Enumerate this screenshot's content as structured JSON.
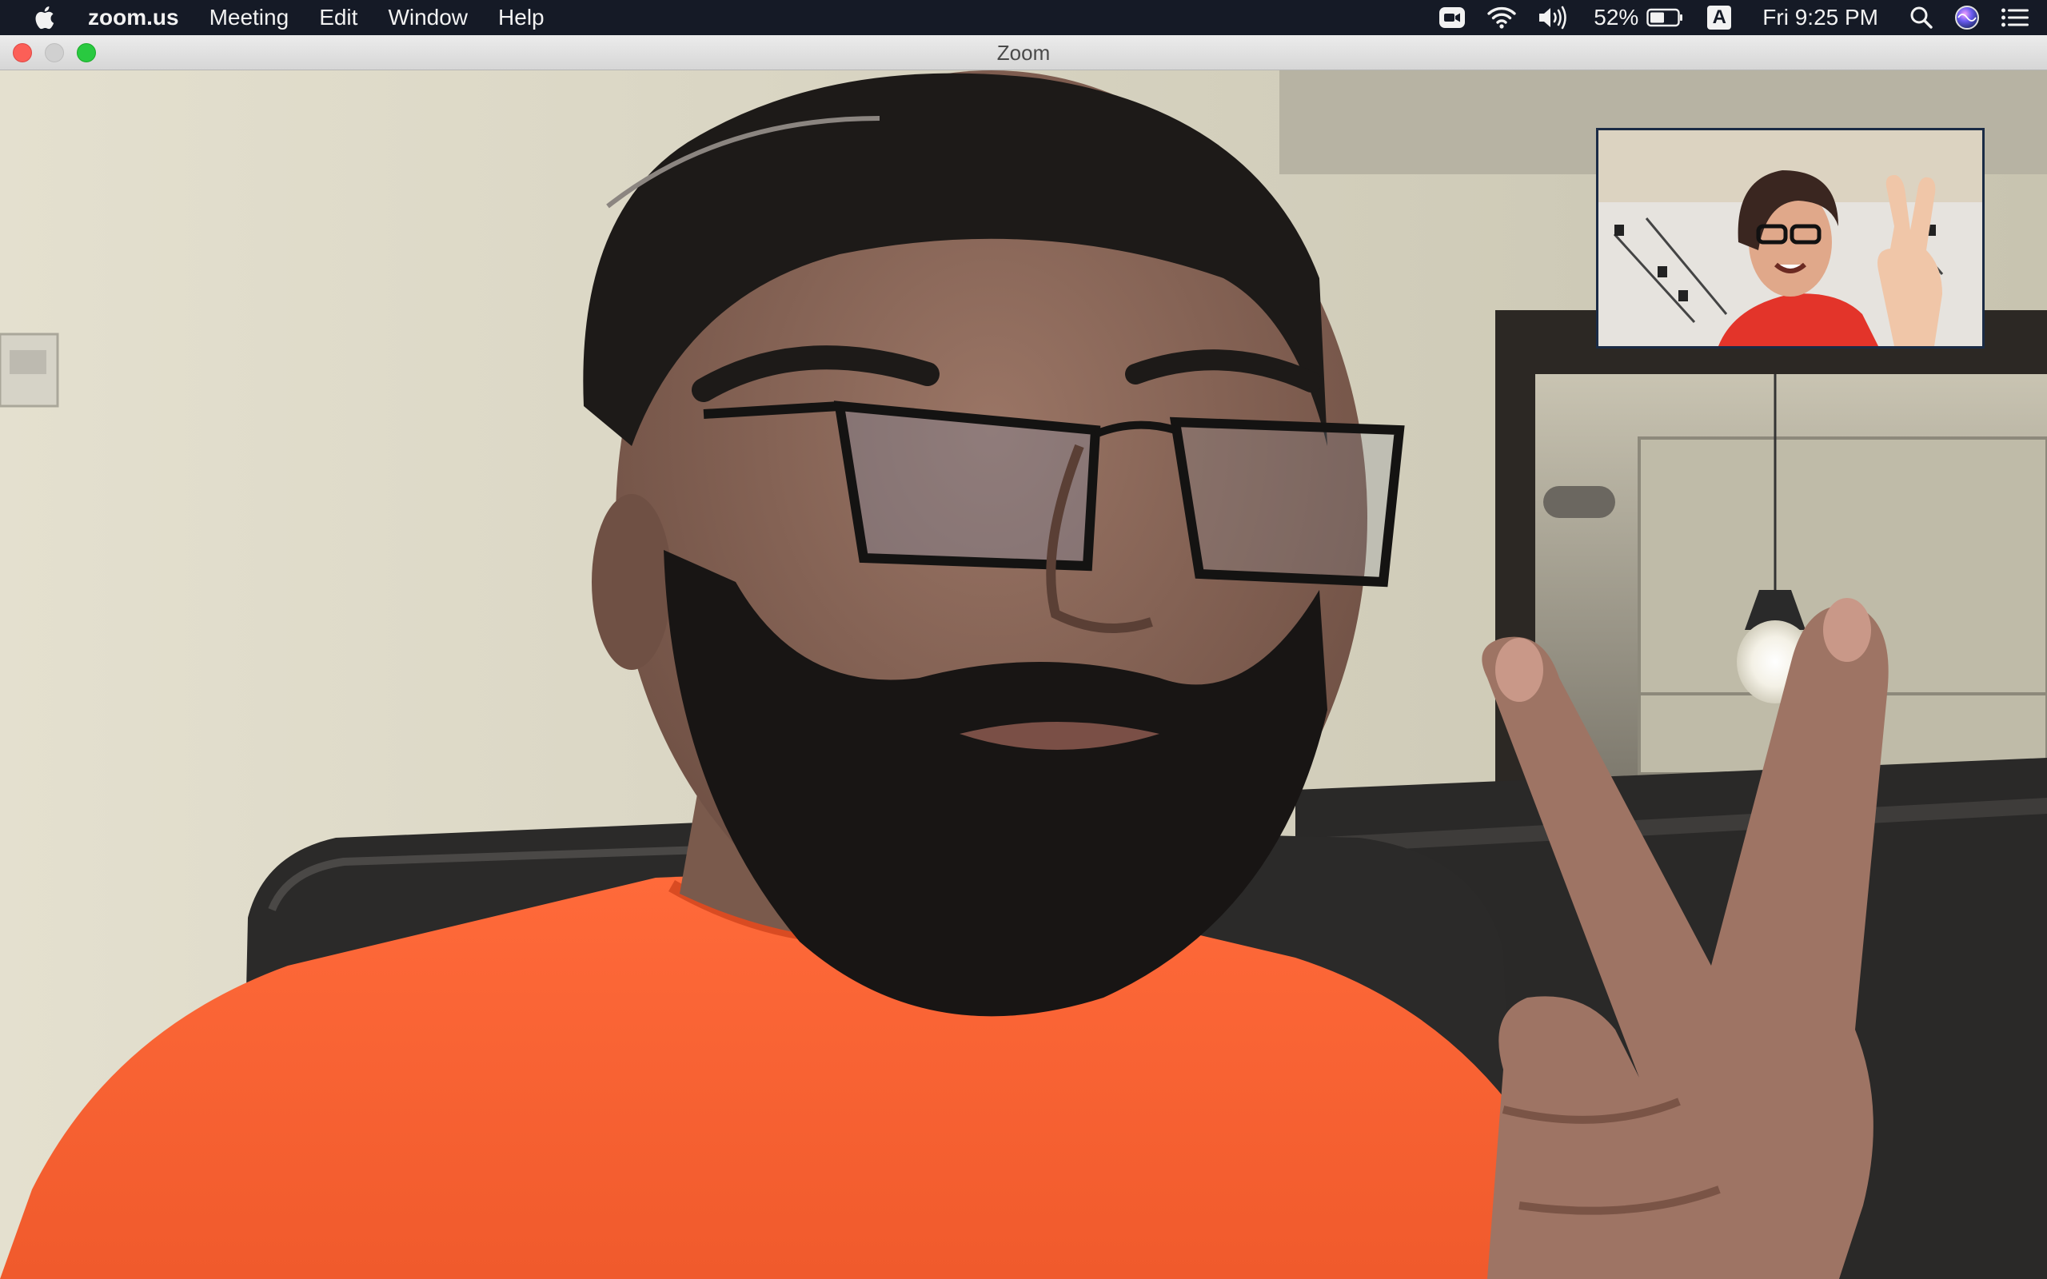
{
  "menubar": {
    "app_name": "zoom.us",
    "items": [
      "Meeting",
      "Edit",
      "Window",
      "Help"
    ],
    "battery_percent": "52%",
    "input_source": "A",
    "clock": "Fri 9:25 PM"
  },
  "window": {
    "title": "Zoom"
  },
  "video": {
    "main_participant_icon": "person-video",
    "self_view_icon": "person-video"
  }
}
